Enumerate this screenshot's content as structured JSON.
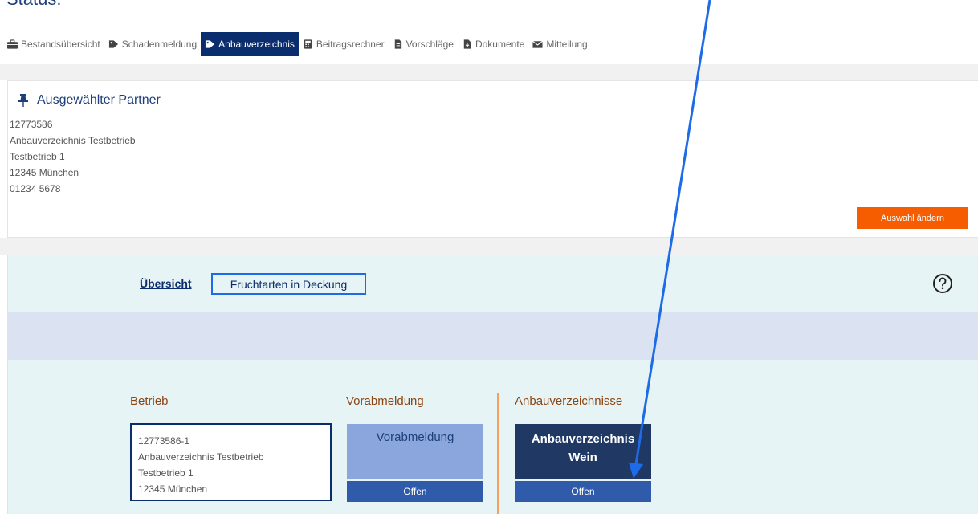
{
  "page": {
    "heading": "Status:"
  },
  "nav": {
    "items": [
      {
        "label": "Bestandsübersicht",
        "icon": "briefcase-icon"
      },
      {
        "label": "Schadenmeldung",
        "icon": "tag-icon"
      },
      {
        "label": "Anbauverzeichnis",
        "icon": "tag-icon",
        "active": true
      },
      {
        "label": "Beitragsrechner",
        "icon": "calculator-icon"
      },
      {
        "label": "Vorschläge",
        "icon": "file-icon"
      },
      {
        "label": "Dokumente",
        "icon": "file-download-icon"
      },
      {
        "label": "Mitteilung",
        "icon": "envelope-icon"
      }
    ]
  },
  "partner": {
    "title": "Ausgewählter Partner",
    "number": "12773586",
    "name": "Anbauverzeichnis Testbetrieb",
    "street": "Testbetrieb 1",
    "city": "12345 München",
    "phone": "01234 5678",
    "change_button": "Auswahl ändern"
  },
  "tabs": {
    "overview": "Übersicht",
    "fruchtarten": "Fruchtarten in Deckung"
  },
  "sections": {
    "betrieb": {
      "heading": "Betrieb",
      "number": "12773586-1",
      "name": "Anbauverzeichnis Testbetrieb",
      "street": "Testbetrieb 1",
      "city": "12345 München"
    },
    "vorabmeldung": {
      "heading": "Vorabmeldung",
      "tile_label": "Vorabmeldung",
      "status": "Offen"
    },
    "anbauverzeichnisse": {
      "heading": "Anbauverzeichnisse",
      "tile_label_line1": "Anbauverzeichnis",
      "tile_label_line2": "Wein",
      "status": "Offen"
    }
  },
  "colors": {
    "nav_active": "#0a2d6e",
    "accent_orange": "#f55d00",
    "teal_bg": "#e7f4f5",
    "tile_light": "#8aa6dd",
    "tile_dark": "#1f3864",
    "status_blue": "#2f5baa",
    "annotation_arrow": "#1e6be8"
  }
}
